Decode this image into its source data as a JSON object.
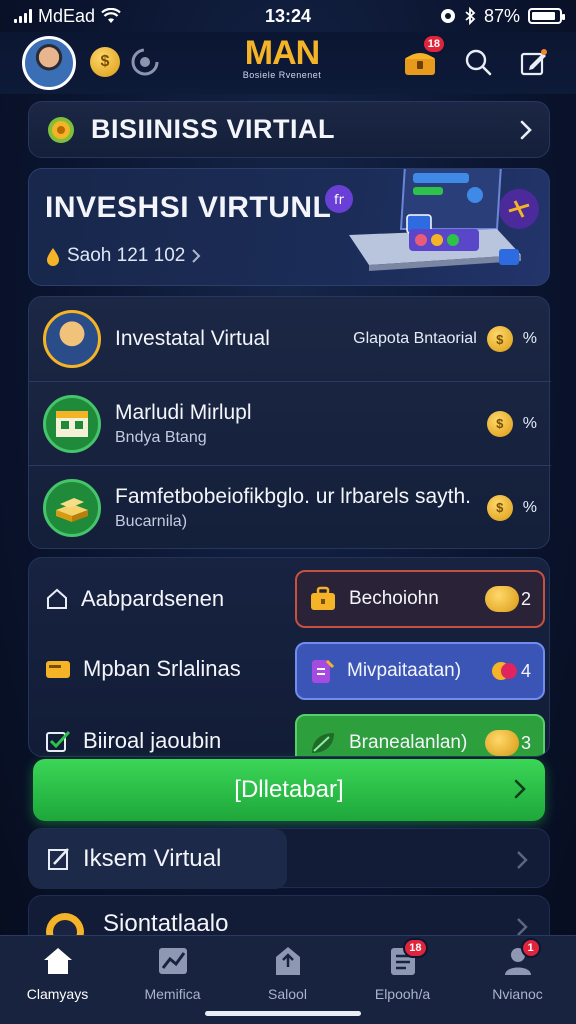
{
  "status_bar": {
    "carrier": "MdEad",
    "time": "13:24",
    "battery": "87%",
    "battery_level": 0.87
  },
  "header": {
    "coin_label": "$",
    "brand_main": "MAN",
    "brand_tagline": "Bosiele Rvenenet",
    "chest_badge": "18"
  },
  "banner": {
    "title": "BISIINISS VIRTIAL"
  },
  "hero": {
    "title": "INVESHSI VIRTUNL",
    "subtitle": "Saoh 121 102"
  },
  "list_items": [
    {
      "title": "Investatal Virtual",
      "subtitle": "",
      "meta": "Glapota Bntaorial",
      "coin": "$",
      "value": "%"
    },
    {
      "title": "Marludi Mirlupl",
      "subtitle": "Bndya Btang",
      "meta": "",
      "coin": "$",
      "value": "%"
    },
    {
      "title": "Famfetbobeiofikbglo. ur lrbarels sayth.",
      "subtitle": "Bucarnila)",
      "meta": "",
      "coin": "$",
      "value": "%"
    }
  ],
  "actions": [
    {
      "left_label": "Aabpardsenen",
      "pill_label": "Bechoiohn",
      "count": "2",
      "pill_bg": "#2a2338",
      "pill_border": "#c8503f"
    },
    {
      "left_label": "Mpban Srlalinas",
      "pill_label": "Mivpaitaatan)",
      "count": "4",
      "pill_bg": "#3a55b5",
      "pill_border": "#6f8cf0"
    },
    {
      "left_label": "Biiroal jaoubin",
      "pill_label": "Branealanlan)",
      "count": "3",
      "pill_bg": "#2d9f3d",
      "pill_border": "#57d06a"
    }
  ],
  "cta": {
    "label": "[Dlletabar]"
  },
  "tool_row": {
    "label": "Iksem Virtual"
  },
  "peek_row": {
    "label": "Siontatlaalo"
  },
  "tabs": [
    {
      "label": "Clamyays",
      "icon": "home-icon",
      "active": true,
      "badge": ""
    },
    {
      "label": "Memifica",
      "icon": "chart-icon",
      "active": false,
      "badge": ""
    },
    {
      "label": "Salool",
      "icon": "building-icon",
      "active": false,
      "badge": ""
    },
    {
      "label": "Elpooh/a",
      "icon": "document-icon",
      "active": false,
      "badge": "18"
    },
    {
      "label": "Nvianoc",
      "icon": "profile-icon",
      "active": false,
      "badge": "1"
    }
  ],
  "colors": {
    "background": "#0b1530",
    "accent_green": "#2ec24a",
    "gold": "#f5b327",
    "badge_red": "#e0243b"
  }
}
